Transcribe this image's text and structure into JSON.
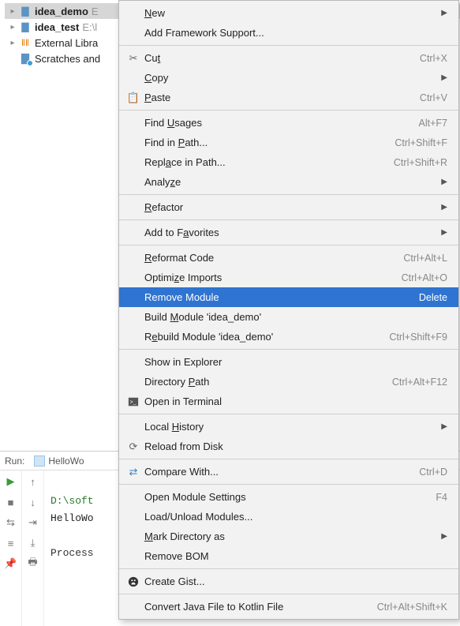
{
  "tree": {
    "items": [
      {
        "name": "idea_demo",
        "bold": true,
        "path": "E"
      },
      {
        "name": "idea_test",
        "bold": true,
        "path": "E:\\l"
      },
      {
        "name": "External Libra"
      },
      {
        "name": "Scratches and"
      }
    ]
  },
  "run": {
    "label": "Run:",
    "tab": "HelloWo",
    "line1": "D:\\soft",
    "line2": "HelloWo",
    "line3": "Process"
  },
  "menu": {
    "new": "New",
    "addFramework": "Add Framework Support...",
    "cut": "Cut",
    "cut_sc": "Ctrl+X",
    "copy": "Copy",
    "paste": "Paste",
    "paste_sc": "Ctrl+V",
    "findUsages": "Find Usages",
    "findUsages_sc": "Alt+F7",
    "findInPath": "Find in Path...",
    "findInPath_sc": "Ctrl+Shift+F",
    "replaceInPath": "Replace in Path...",
    "replaceInPath_sc": "Ctrl+Shift+R",
    "analyze": "Analyze",
    "refactor": "Refactor",
    "addFav": "Add to Favorites",
    "reformat": "Reformat Code",
    "reformat_sc": "Ctrl+Alt+L",
    "optimize": "Optimize Imports",
    "optimize_sc": "Ctrl+Alt+O",
    "remove": "Remove Module",
    "remove_sc": "Delete",
    "build": "Build Module 'idea_demo'",
    "rebuild": "Rebuild Module 'idea_demo'",
    "rebuild_sc": "Ctrl+Shift+F9",
    "showExplorer": "Show in Explorer",
    "dirPath": "Directory Path",
    "dirPath_sc": "Ctrl+Alt+F12",
    "openTerm": "Open in Terminal",
    "localHist": "Local History",
    "reload": "Reload from Disk",
    "compare": "Compare With...",
    "compare_sc": "Ctrl+D",
    "openModSet": "Open Module Settings",
    "openModSet_sc": "F4",
    "loadUnload": "Load/Unload Modules...",
    "markDir": "Mark Directory as",
    "removeBOM": "Remove BOM",
    "createGist": "Create Gist...",
    "convert": "Convert Java File to Kotlin File",
    "convert_sc": "Ctrl+Alt+Shift+K"
  }
}
